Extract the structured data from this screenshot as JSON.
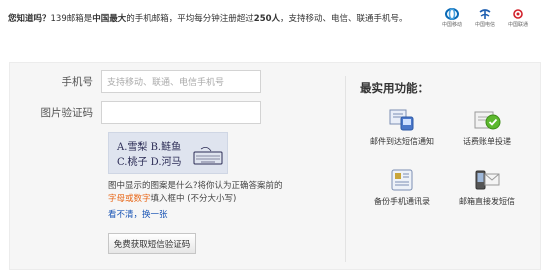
{
  "header": {
    "did_you_know": "您知道吗？",
    "text_a": "139邮箱是",
    "text_b": "中国最大",
    "text_c": "的手机邮箱，平均每分钟注册超过",
    "text_d": "250人",
    "text_e": "，支持移动、电信、联通手机号。",
    "logos": [
      {
        "name": "中国移动",
        "icon": "china-mobile-logo",
        "color": "#0a6ab6"
      },
      {
        "name": "中国电信",
        "icon": "china-telecom-logo",
        "color": "#1f5fb0"
      },
      {
        "name": "中国联通",
        "icon": "china-unicom-logo",
        "color": "#d2202a"
      }
    ]
  },
  "form": {
    "phone_label": "手机号",
    "phone_placeholder": "支持移动、联通、电信手机号",
    "captcha_label": "图片验证码",
    "captcha_value": "",
    "captcha_image": {
      "line1": "A.雪梨 B.鲢鱼",
      "line2": "C.桃子 D.河马",
      "icon": "keyboard-icon"
    },
    "hint_prefix": "图中显示的图案是什么?将你认为正确答案前的",
    "hint_highlight": "字母或数字",
    "hint_suffix": "填入框中 (不分大小写)",
    "refresh_link": "看不清，换一张",
    "sms_button": "免费获取短信验证码"
  },
  "features": {
    "title": "最实用功能：",
    "items": [
      {
        "label": "邮件到达短信通知",
        "icon": "mail-sms-icon"
      },
      {
        "label": "话费账单投递",
        "icon": "bill-delivery-icon"
      },
      {
        "label": "备份手机通讯录",
        "icon": "contacts-backup-icon"
      },
      {
        "label": "邮箱直接发短信",
        "icon": "send-sms-icon"
      }
    ]
  },
  "colors": {
    "accent_orange": "#e8681a",
    "link_blue": "#1a55b5",
    "panel_bg": "#f6f6f6"
  }
}
